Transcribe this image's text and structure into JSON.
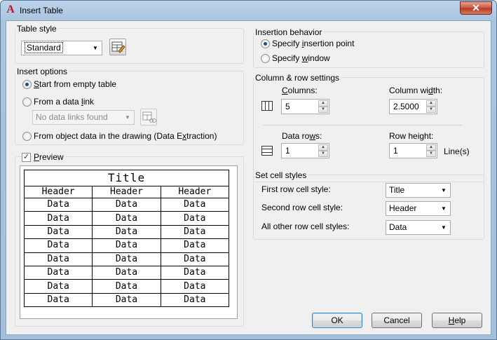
{
  "window": {
    "title": "Insert Table",
    "close_glyph": "✕",
    "app_icon": "autocad-logo-icon",
    "app_icon_glyph": "A"
  },
  "table_style": {
    "legend": "Table style",
    "selected": "Standard",
    "button_icon": "table-style-dialog-icon"
  },
  "insert_options": {
    "legend": "Insert options",
    "start_empty": {
      "label": "Start from empty table",
      "selected": true
    },
    "from_data_link": {
      "label": "From a data link",
      "selected": false
    },
    "data_link_combo": {
      "value": "No data links found",
      "enabled": false
    },
    "from_object_data": {
      "label": "From object data in the drawing (Data Extraction)",
      "selected": false
    }
  },
  "preview": {
    "label": "Preview",
    "checked": true,
    "title": "Title",
    "headers": [
      "Header",
      "Header",
      "Header"
    ],
    "rows": [
      [
        "Data",
        "Data",
        "Data"
      ],
      [
        "Data",
        "Data",
        "Data"
      ],
      [
        "Data",
        "Data",
        "Data"
      ],
      [
        "Data",
        "Data",
        "Data"
      ],
      [
        "Data",
        "Data",
        "Data"
      ],
      [
        "Data",
        "Data",
        "Data"
      ],
      [
        "Data",
        "Data",
        "Data"
      ],
      [
        "Data",
        "Data",
        "Data"
      ]
    ]
  },
  "insertion_behavior": {
    "legend": "Insertion behavior",
    "specify_point": {
      "label": "Specify insertion point",
      "selected": true
    },
    "specify_window": {
      "label": "Specify window",
      "selected": false
    }
  },
  "column_row": {
    "legend": "Column & row settings",
    "columns_label": "Columns:",
    "columns_value": "5",
    "column_width_label": "Column width:",
    "column_width_value": "2.5000",
    "data_rows_label": "Data rows:",
    "data_rows_value": "1",
    "row_height_label": "Row height:",
    "row_height_value": "1",
    "row_height_unit": "Line(s)"
  },
  "cell_styles": {
    "legend": "Set cell styles",
    "first_row_label": "First row cell style:",
    "first_row_value": "Title",
    "second_row_label": "Second row cell style:",
    "second_row_value": "Header",
    "other_rows_label": "All other row cell styles:",
    "other_rows_value": "Data"
  },
  "buttons": {
    "ok": "OK",
    "cancel": "Cancel",
    "help": "Help"
  },
  "colors": {
    "accent": "#3c7fb1",
    "title_bar": "#bcd3ea",
    "close": "#c7543c"
  }
}
